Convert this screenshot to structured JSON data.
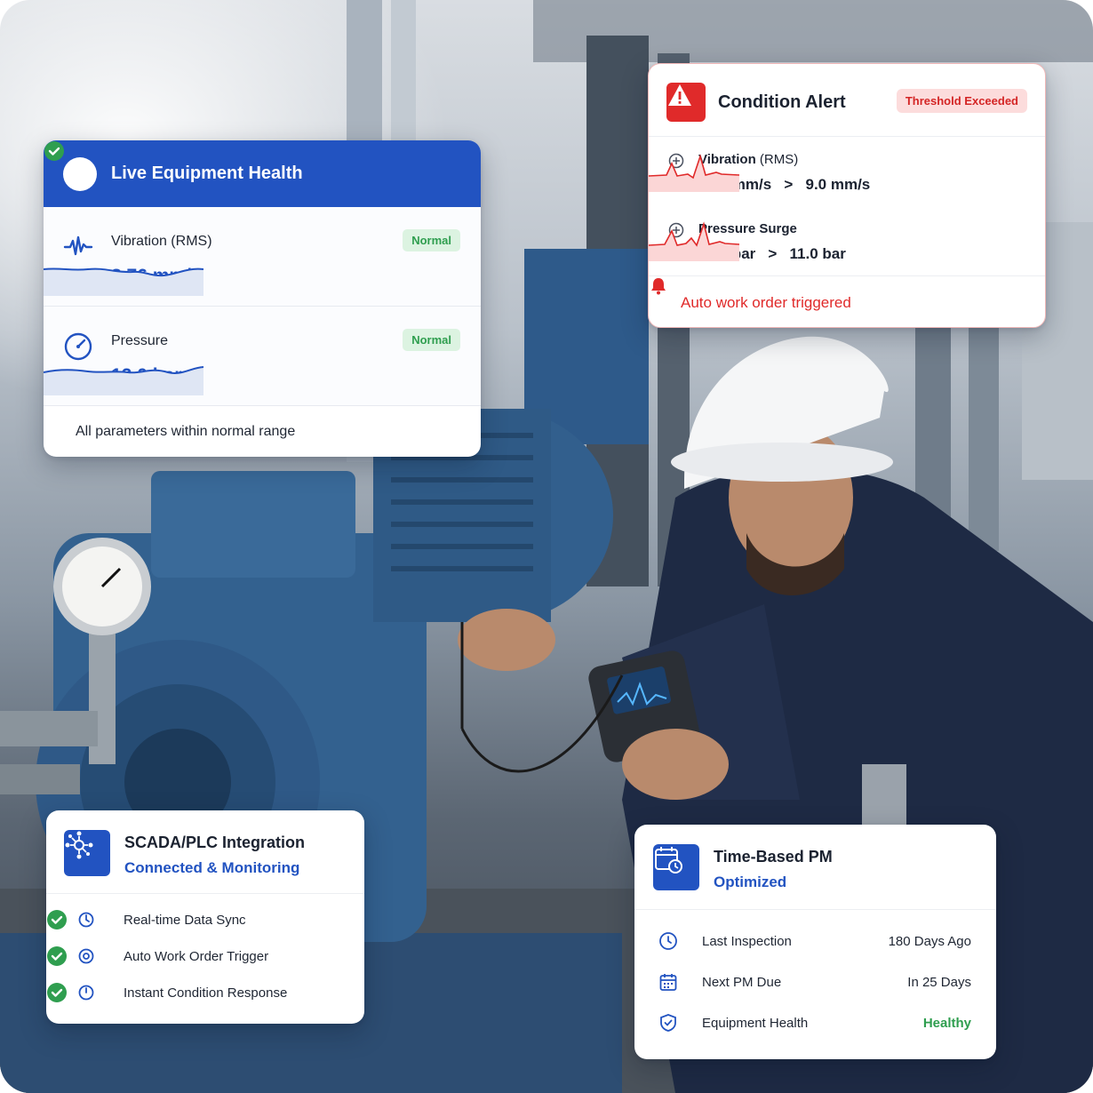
{
  "health_card": {
    "title": "Live Equipment Health",
    "metrics": [
      {
        "label": "Vibration (RMS)",
        "value": "8.76 mm/s",
        "status": "Normal"
      },
      {
        "label": "Pressure",
        "value": "12.0 bar",
        "status": "Normal"
      }
    ],
    "footer": "All parameters within normal range"
  },
  "alert_card": {
    "title": "Condition Alert",
    "badge": "Threshold Exceeded",
    "rows": [
      {
        "label": "Vibration",
        "sublabel": "(RMS)",
        "values": "12.0 mm/s   >   9.0 mm/s"
      },
      {
        "label": "Pressure Surge",
        "sublabel": "",
        "values": "12.5 bar   >   11.0 bar"
      }
    ],
    "footer": "Auto work order triggered"
  },
  "scada_card": {
    "title": "SCADA/PLC Integration",
    "subtitle": "Connected & Monitoring",
    "items": [
      {
        "label": "Real-time Data Sync",
        "icon": "sync-icon"
      },
      {
        "label": "Auto Work Order Trigger",
        "icon": "gear-icon"
      },
      {
        "label": "Instant Condition Response",
        "icon": "power-icon"
      }
    ]
  },
  "pm_card": {
    "title": "Time-Based PM",
    "subtitle": "Optimized",
    "rows": [
      {
        "label": "Last Inspection",
        "value": "180 Days Ago",
        "icon": "clock-icon"
      },
      {
        "label": "Next PM Due",
        "value": "In 25 Days",
        "icon": "calendar-icon"
      },
      {
        "label": "Equipment Health",
        "value": "Healthy",
        "icon": "shield-icon"
      }
    ]
  },
  "colors": {
    "primary": "#2253c1",
    "alert": "#e02a2a",
    "success": "#2f9e4f"
  }
}
